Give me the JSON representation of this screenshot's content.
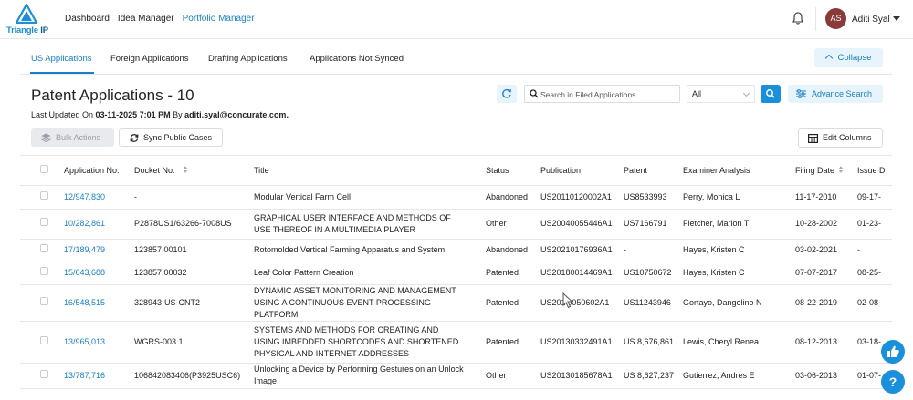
{
  "brand": {
    "name_prefix": "Triangle ",
    "name_suffix": "IP"
  },
  "nav": {
    "items": [
      "Dashboard",
      "Idea Manager",
      "Portfolio Manager"
    ],
    "active": "Portfolio Manager"
  },
  "user": {
    "initials": "AS",
    "name": "Aditi Syal"
  },
  "tabs": [
    "US Applications",
    "Foreign Applications",
    "Drafting Applications",
    "Applications Not Synced"
  ],
  "collapse_label": "Collapse",
  "page": {
    "title": "Patent Applications - 10",
    "updated_prefix": "Last Updated On ",
    "updated_date": "03-11-2025 7:01 PM",
    "updated_by": " By ",
    "updated_user": "aditi.syal@concurate.com."
  },
  "search": {
    "placeholder": "Search in Filed Applications",
    "filter_value": "All"
  },
  "buttons": {
    "advance_search": "Advance Search",
    "bulk_actions": "Bulk Actions",
    "sync": "Sync Public Cases",
    "edit_columns": "Edit Columns"
  },
  "table": {
    "headers": {
      "app_no": "Application No.",
      "docket": "Docket No.",
      "title": "Title",
      "status": "Status",
      "publication": "Publication",
      "patent": "Patent",
      "examiner": "Examiner Analysis",
      "filing": "Filing Date",
      "issue": "Issue D"
    },
    "rows": [
      {
        "app_no": "12/947,830",
        "docket": "-",
        "title": "Modular Vertical Farm Cell",
        "status": "Abandoned",
        "publication": "US20110120002A1",
        "patent": "US8533993",
        "examiner": "Perry, Monica L",
        "filing": "11-17-2010",
        "issue": "09-17-"
      },
      {
        "app_no": "10/282,861",
        "docket": "P2878US1/63266-7008US",
        "title": "GRAPHICAL USER INTERFACE AND METHODS OF USE THEREOF IN A MULTIMEDIA PLAYER",
        "status": "Other",
        "publication": "US20040055446A1",
        "patent": "US7166791",
        "examiner": "Fletcher, Marlon T",
        "filing": "10-28-2002",
        "issue": "01-23-"
      },
      {
        "app_no": "17/189,479",
        "docket": "123857.00101",
        "title": "Rotomolded Vertical Farming Apparatus and System",
        "status": "Abandoned",
        "publication": "US20210176936A1",
        "patent": "-",
        "examiner": "Hayes, Kristen C",
        "filing": "03-02-2021",
        "issue": "-"
      },
      {
        "app_no": "15/643,688",
        "docket": "123857.00032",
        "title": "Leaf Color Pattern Creation",
        "status": "Patented",
        "publication": "US20180014469A1",
        "patent": "US10750672",
        "examiner": "Hayes, Kristen C",
        "filing": "07-07-2017",
        "issue": "08-25-"
      },
      {
        "app_no": "16/548,515",
        "docket": "328943-US-CNT2",
        "title": "DYNAMIC ASSET MONITORING AND MANAGEMENT USING A CONTINUOUS EVENT PROCESSING PLATFORM",
        "status": "Patented",
        "publication": "US201 0050602A1",
        "patent": "US11243946",
        "examiner": "Gortayo, Dangelino N",
        "filing": "08-22-2019",
        "issue": "02-08-"
      },
      {
        "app_no": "13/965,013",
        "docket": "WGRS-003.1",
        "title": "SYSTEMS AND METHODS FOR CREATING AND USING IMBEDDED SHORTCODES AND SHORTENED PHYSICAL AND INTERNET ADDRESSES",
        "status": "Patented",
        "publication": "US20130332491A1",
        "patent": "US 8,676,861",
        "examiner": "Lewis, Cheryl Renea",
        "filing": "08-12-2013",
        "issue": "03-18-"
      },
      {
        "app_no": "13/787,716",
        "docket": "106842083406(P3925USC6)",
        "title": "Unlocking a Device by Performing Gestures on an Unlock Image",
        "status": "Other",
        "publication": "US20130185678A1",
        "patent": "US 8,627,237",
        "examiner": "Gutierrez, Andres E",
        "filing": "03-06-2013",
        "issue": "01-07-"
      }
    ]
  },
  "colors": {
    "accent": "#1a7fc9",
    "accent_light": "#e8f4fb",
    "button_blue": "#1a8fdc"
  },
  "icons": [
    "triangle-logo-icon",
    "bell-icon",
    "refresh-icon",
    "search-icon",
    "sliders-icon",
    "layers-icon",
    "sync-icon",
    "columns-icon",
    "thumbs-up-icon",
    "help-icon"
  ],
  "help_label": "?"
}
